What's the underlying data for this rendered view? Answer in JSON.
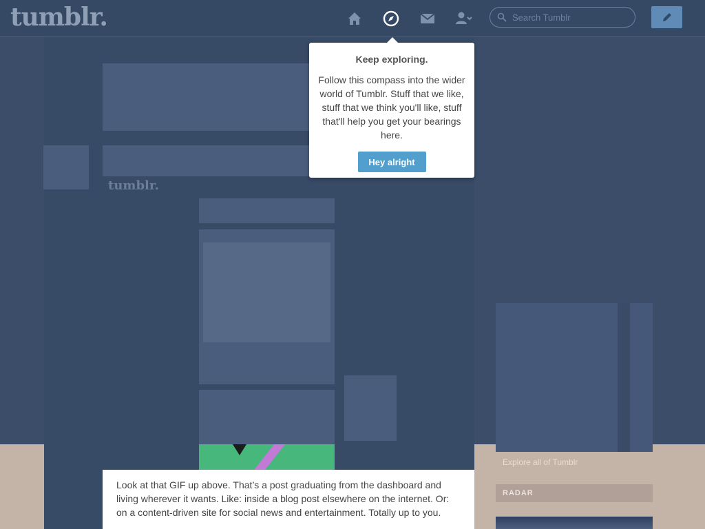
{
  "header": {
    "logo": "tumblr.",
    "search_placeholder": "Search Tumblr"
  },
  "popover": {
    "title": "Keep exploring.",
    "body": "Follow this compass into the wider world of Tumblr. Stuff that we like, stuff that we think you'll like, stuff that'll help you get your bearings here.",
    "button": "Hey alright"
  },
  "article": {
    "paragraph": "Look at that GIF up above. That’s a post graduating from the dashboard and living wherever it wants. Like: inside a blog post elsewhere on the internet. Or: on a content-driven site for social news and entertainment. Totally up to you."
  },
  "sidebar": {
    "explore_link": "Explore all of Tumblr",
    "radar_heading": "RADAR"
  },
  "background": {
    "faint_logo": "tumblr."
  },
  "colors": {
    "header_bg": "#364964",
    "overlay": "#3b4d68",
    "accent_button": "#529ecc",
    "page_bg": "#c4b3a7"
  }
}
